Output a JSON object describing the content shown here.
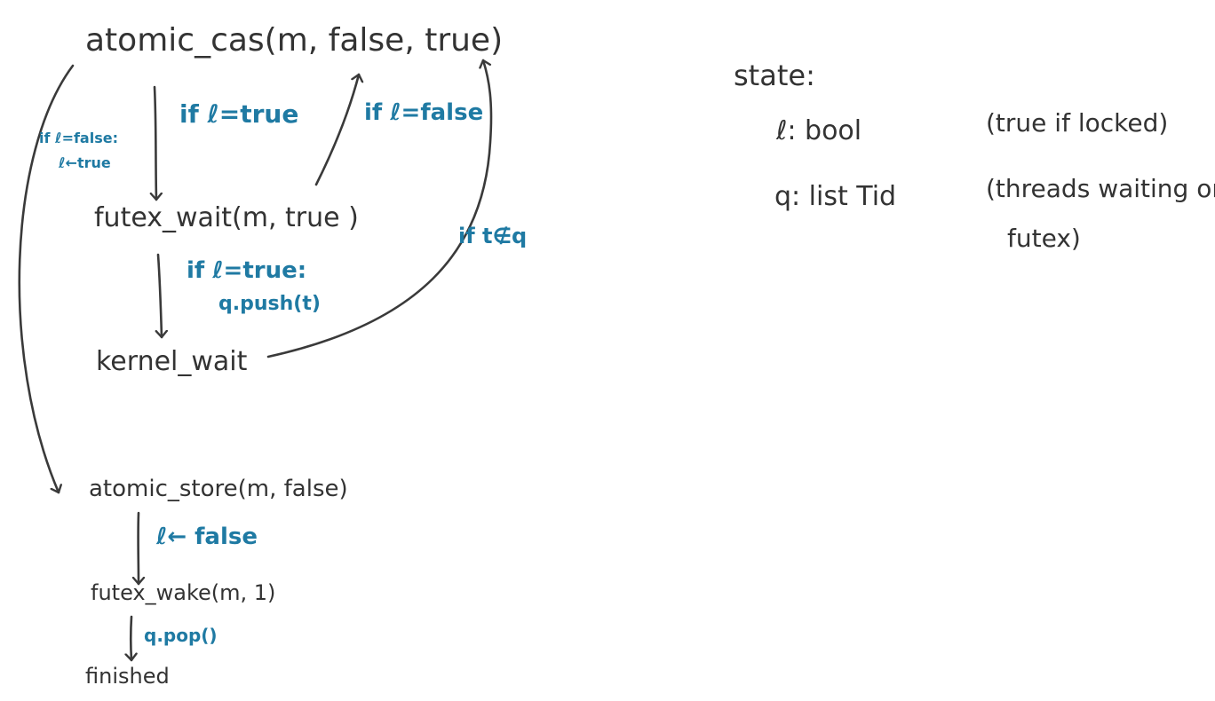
{
  "colors": {
    "ink": "#333333",
    "annotation": "#1f7aa3",
    "background": "#ffffff"
  },
  "nodes": {
    "atomic_cas": "atomic_cas(m, false, true)",
    "futex_wait": "futex_wait(m, true )",
    "kernel_wait": "kernel_wait",
    "atomic_store": "atomic_store(m, false)",
    "futex_wake": "futex_wake(m, 1)",
    "finished": "finished"
  },
  "conditions": {
    "if_l_false_line1": "if ℓ=false:",
    "if_l_false_line2": "ℓ←true",
    "if_l_true": "if ℓ=true",
    "if_l_false_retry": "if ℓ=false",
    "if_t_not_in_q": "if t∉q",
    "if_l_true_push_line1": "if ℓ=true:",
    "if_l_true_push_line2": "q.push(t)",
    "l_set_false": "ℓ← false",
    "q_pop": "q.pop()"
  },
  "state": {
    "title": "state:",
    "l_name": "ℓ: bool",
    "l_desc": "(true if locked)",
    "q_name": "q: list Tid",
    "q_desc_line1": "(threads waiting on",
    "q_desc_line2": "futex)"
  }
}
